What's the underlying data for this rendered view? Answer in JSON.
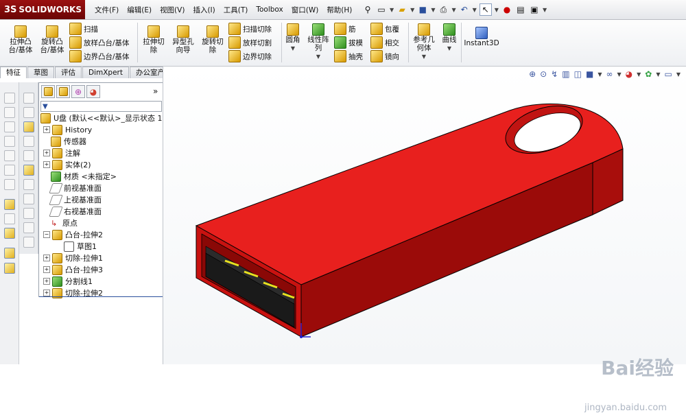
{
  "app": {
    "logo": "SOLIDWORKS",
    "logo_prefix": "3S"
  },
  "menu": [
    "文件(F)",
    "编辑(E)",
    "视图(V)",
    "插入(I)",
    "工具(T)",
    "Toolbox",
    "窗口(W)",
    "帮助(H)"
  ],
  "ribbon": {
    "boss_extrude": "拉伸凸\n台/基体",
    "revolve_boss": "旋转凸\n台/基体",
    "sweep": "扫描",
    "loft_boss": "放样凸台/基体",
    "boundary_boss": "边界凸台/基体",
    "extrude_cut": "拉伸切\n除",
    "hole_wizard": "异型孔\n向导",
    "revolve_cut": "旋转切\n除",
    "sweep_cut": "扫描切除",
    "loft_cut": "放样切割",
    "boundary_cut": "边界切除",
    "fillet": "圆角",
    "linear_pattern": "线性阵\n列",
    "rib": "筋",
    "draft": "拔模",
    "shell": "抽壳",
    "wrap": "包覆",
    "intersect": "相交",
    "mirror": "镜向",
    "ref_geometry": "参考几\n何体",
    "curves": "曲线",
    "instant3d": "Instant3D"
  },
  "tabs": [
    "特征",
    "草图",
    "评估",
    "DimXpert",
    "办公室产品"
  ],
  "tree": {
    "root": "U盘 (默认<<默认>_显示状态 1",
    "items": [
      "History",
      "传感器",
      "注解",
      "实体(2)",
      "材质 <未指定>",
      "前视基准面",
      "上视基准面",
      "右视基准面",
      "原点",
      "凸台-拉伸2",
      "草图1",
      "切除-拉伸1",
      "凸台-拉伸3",
      "分割线1",
      "切除-拉伸2"
    ]
  },
  "watermark": {
    "brand": "Bai经验",
    "url": "jingyan.baidu.com"
  },
  "colors": {
    "model_red": "#e8201e",
    "model_dark": "#a80e0c",
    "model_shadow": "#7a0606",
    "connector": "#1a1a1a",
    "contact": "#e8e020"
  }
}
